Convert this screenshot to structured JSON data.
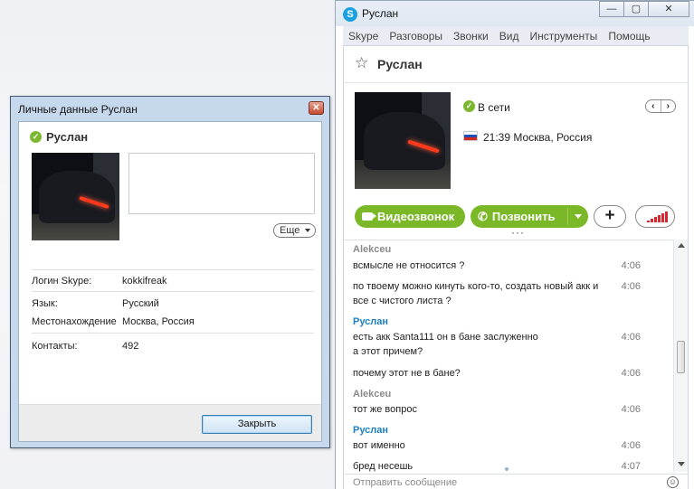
{
  "skype_window": {
    "title": "Руслан",
    "window_buttons": [
      "—",
      "▢",
      "✕"
    ],
    "menu": [
      "Skype",
      "Разговоры",
      "Звонки",
      "Вид",
      "Инструменты",
      "Помощь"
    ],
    "contact_name": "Руслан",
    "status": "В сети",
    "time_location": "21:39 Москва, Россия",
    "nav_prev": "‹",
    "nav_next": "›",
    "video_call_label": "Видеозвонок",
    "call_label": "Позвонить",
    "add_label": "+",
    "presence_color": "#7cb82f",
    "accent_green": "#7ab827",
    "messages": [
      {
        "author": "Alekceu",
        "author_color": "gray",
        "text": "",
        "time": ""
      },
      {
        "author": "",
        "author_color": "",
        "text": "всмысле не относится ?",
        "time": "4:06"
      },
      {
        "author": "",
        "author_color": "",
        "text": "по твоему можно кинуть кого-то, создать новый акк и",
        "time": "4:06"
      },
      {
        "author": "",
        "author_color": "",
        "text": "все с чистого листа ?",
        "time": ""
      },
      {
        "author": "Руслан",
        "author_color": "blue",
        "text": "",
        "time": ""
      },
      {
        "author": "",
        "author_color": "",
        "text": "есть акк Santa111 он в бане заслуженно",
        "time": "4:06"
      },
      {
        "author": "",
        "author_color": "",
        "text": "а этот причем?",
        "time": ""
      },
      {
        "author": "",
        "author_color": "",
        "text": "почему этот не в бане?",
        "time": "4:06"
      },
      {
        "author": "Alekceu",
        "author_color": "gray",
        "text": "",
        "time": ""
      },
      {
        "author": "",
        "author_color": "",
        "text": "тот же вопрос",
        "time": "4:06"
      },
      {
        "author": "Руслан",
        "author_color": "blue",
        "text": "",
        "time": ""
      },
      {
        "author": "",
        "author_color": "",
        "text": "вот именно",
        "time": "4:06"
      },
      {
        "author": "",
        "author_color": "",
        "text": "бред несешь",
        "time": "4:07"
      }
    ],
    "compose_placeholder": "Отправить сообщение"
  },
  "profile_dialog": {
    "title": "Личные данные Руслан",
    "close_glyph": "✕",
    "name": "Руслан",
    "more_label": "Еще",
    "fields": {
      "login_label": "Логин Skype:",
      "login_value": "kokkifreak",
      "language_label": "Язык:",
      "language_value": "Русский",
      "location_label": "Местонахождение",
      "location_value": "Москва, Россия",
      "contacts_label": "Контакты:",
      "contacts_value": "492"
    },
    "close_button_label": "Закрыть"
  }
}
